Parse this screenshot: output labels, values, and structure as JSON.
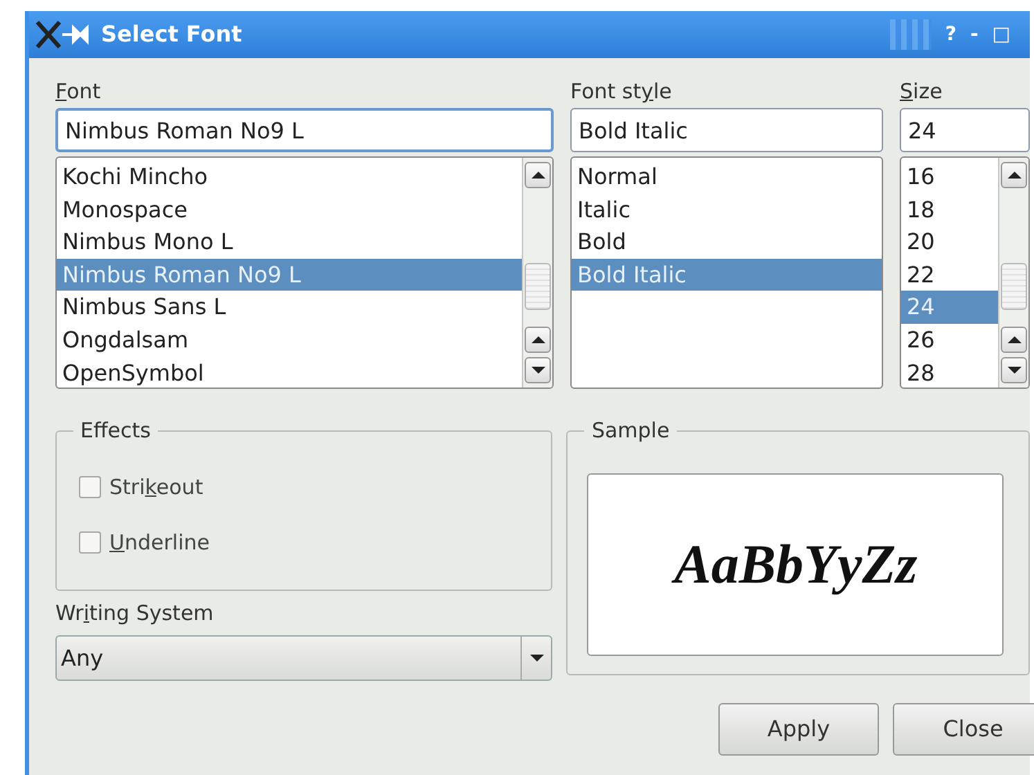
{
  "window": {
    "title": "Select Font",
    "controls": [
      "?",
      "-",
      "□"
    ]
  },
  "font": {
    "label": {
      "key": "F",
      "post": "ont"
    },
    "value": "Nimbus Roman No9 L",
    "items": [
      {
        "label": "Kochi Mincho",
        "selected": false
      },
      {
        "label": "Monospace",
        "selected": false
      },
      {
        "label": "Nimbus Mono L",
        "selected": false
      },
      {
        "label": "Nimbus Roman No9 L",
        "selected": true
      },
      {
        "label": "Nimbus Sans L",
        "selected": false
      },
      {
        "label": "Ongdalsam",
        "selected": false
      },
      {
        "label": "OpenSymbol",
        "selected": false
      }
    ]
  },
  "font_style": {
    "label": {
      "pre": "Font st",
      "key": "y",
      "post": "le"
    },
    "value": "Bold Italic",
    "items": [
      {
        "label": "Normal",
        "selected": false
      },
      {
        "label": "Italic",
        "selected": false
      },
      {
        "label": "Bold",
        "selected": false
      },
      {
        "label": "Bold Italic",
        "selected": true
      }
    ]
  },
  "size": {
    "label": {
      "key": "S",
      "post": "ize"
    },
    "value": "24",
    "items": [
      {
        "label": "16",
        "selected": false
      },
      {
        "label": "18",
        "selected": false
      },
      {
        "label": "20",
        "selected": false
      },
      {
        "label": "22",
        "selected": false
      },
      {
        "label": "24",
        "selected": true
      },
      {
        "label": "26",
        "selected": false
      },
      {
        "label": "28",
        "selected": false
      }
    ]
  },
  "effects": {
    "title": "Effects",
    "options": [
      {
        "label": {
          "pre": "Stri",
          "key": "k",
          "post": "eout"
        },
        "checked": false
      },
      {
        "label": {
          "key": "U",
          "post": "nderline"
        },
        "checked": false
      }
    ]
  },
  "writing_system": {
    "label": {
      "pre": "Wr",
      "key": "i",
      "post": "ting System"
    },
    "value": "Any"
  },
  "sample": {
    "title": "Sample",
    "text": "AaBbYyZz"
  },
  "buttons": [
    "Apply",
    "Close"
  ]
}
